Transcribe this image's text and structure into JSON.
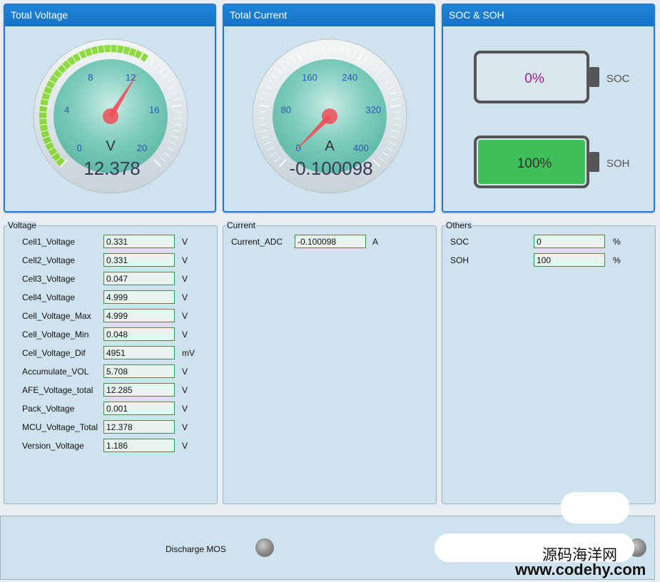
{
  "panels": {
    "voltage": {
      "title": "Total Voltage",
      "unit": "V",
      "value": 12.378,
      "value_text": "12.378",
      "min": 0,
      "max": 20,
      "ticks": [
        "0",
        "4",
        "8",
        "12",
        "16",
        "20"
      ],
      "needle_color": "#ef4f5a",
      "arc_color": "#7ed321"
    },
    "current": {
      "title": "Total Current",
      "unit": "A",
      "value": -0.100098,
      "value_text": "-0.100098",
      "min": 0,
      "max": 400,
      "ticks": [
        "0",
        "80",
        "160",
        "240",
        "320",
        "400"
      ],
      "needle_color": "#ef4f5a"
    },
    "soc_soh": {
      "title": "SOC & SOH",
      "soc": {
        "label": "SOC",
        "value": 0,
        "text": "0%",
        "text_color": "#a0208a"
      },
      "soh": {
        "label": "SOH",
        "value": 100,
        "text": "100%",
        "fill_color": "#3fbf5a"
      }
    }
  },
  "voltage_group": {
    "title": "Voltage",
    "rows": [
      {
        "label": "Cell1_Voltage",
        "value": "0.331",
        "unit": "V"
      },
      {
        "label": "Cell2_Voltage",
        "value": "0.331",
        "unit": "V"
      },
      {
        "label": "Cell3_Voltage",
        "value": "0.047",
        "unit": "V"
      },
      {
        "label": "Cell4_Voltage",
        "value": "4.999",
        "unit": "V"
      },
      {
        "label": "Cell_Voltage_Max",
        "value": "4.999",
        "unit": "V"
      },
      {
        "label": "Cell_Voltage_Min",
        "value": "0.048",
        "unit": "V"
      },
      {
        "label": "Cell_Voltage_Dif",
        "value": "4951",
        "unit": "mV"
      },
      {
        "label": "Accumulate_VOL",
        "value": "5.708",
        "unit": "V"
      },
      {
        "label": "AFE_Voltage_total",
        "value": "12.285",
        "unit": "V"
      },
      {
        "label": "Pack_Voltage",
        "value": "0.001",
        "unit": "V"
      },
      {
        "label": "MCU_Voltage_Total",
        "value": "12.378",
        "unit": "V"
      },
      {
        "label": "Version_Voltage",
        "value": "1.186",
        "unit": "V"
      }
    ]
  },
  "current_group": {
    "title": "Current",
    "rows": [
      {
        "label": "Current_ADC",
        "value": "-0.100098",
        "unit": "A"
      }
    ]
  },
  "others_group": {
    "title": "Others",
    "rows": [
      {
        "label": "SOC",
        "value": "0",
        "unit": "%"
      },
      {
        "label": "SOH",
        "value": "100",
        "unit": "%"
      }
    ]
  },
  "bottom": {
    "discharge_mos_label": "Discharge MOS"
  },
  "watermark": {
    "cn": "源码海洋网",
    "url": "www.codehy.com"
  }
}
